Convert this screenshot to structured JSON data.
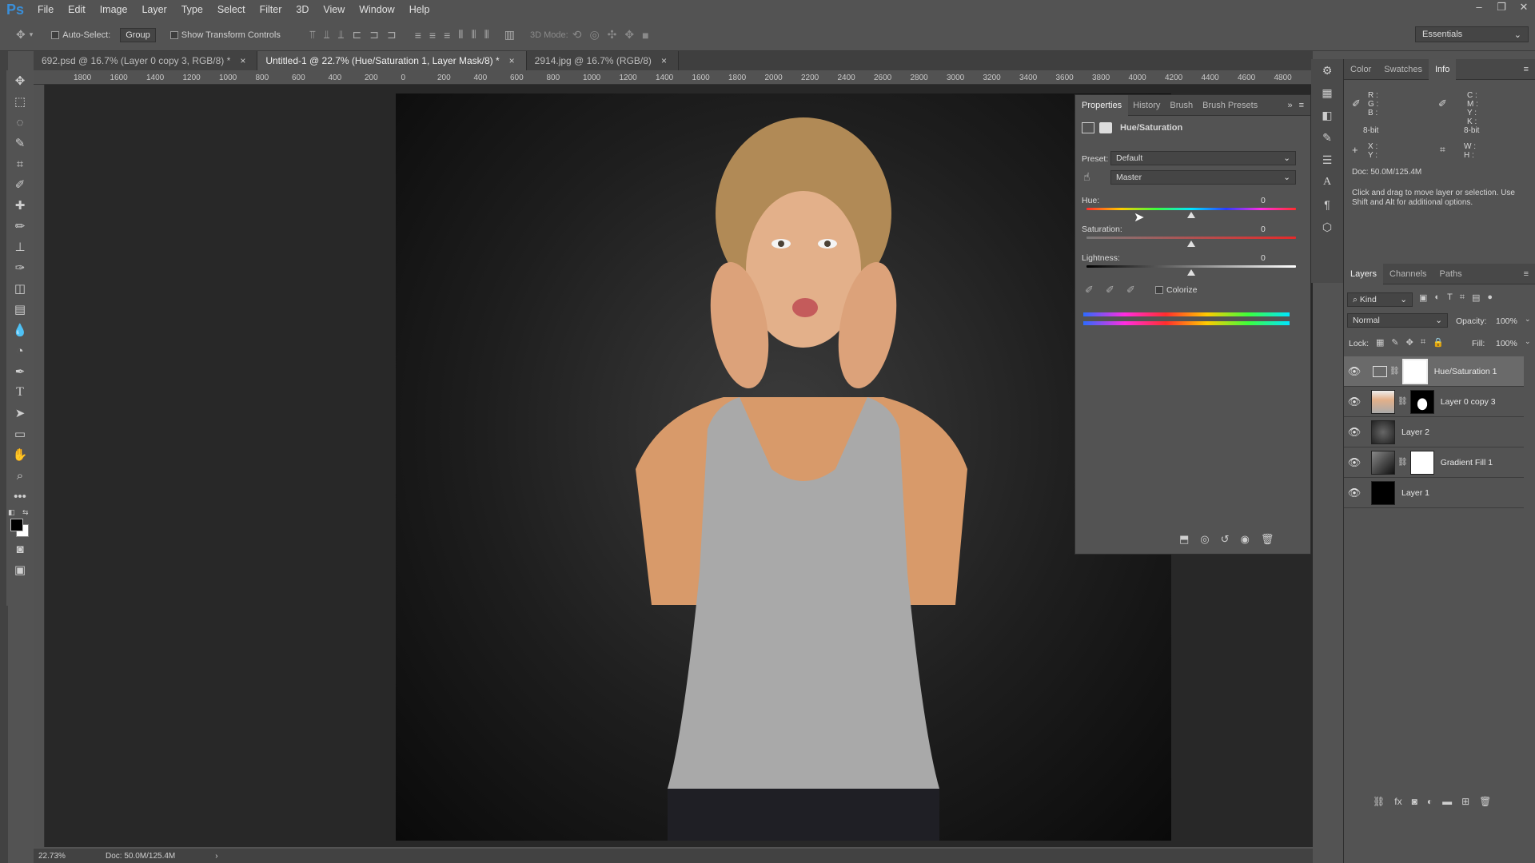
{
  "app": {
    "logo": "Ps"
  },
  "menu": [
    "File",
    "Edit",
    "Image",
    "Layer",
    "Type",
    "Select",
    "Filter",
    "3D",
    "View",
    "Window",
    "Help"
  ],
  "window_controls": {
    "minimize": "–",
    "restore": "❐",
    "close": "✕"
  },
  "options": {
    "auto_select_label": "Auto-Select:",
    "auto_select_value": "Group",
    "transform_label": "Show Transform Controls",
    "mode_3d_label": "3D Mode:"
  },
  "workspace": "Essentials",
  "tabs": [
    {
      "label": "692.psd @ 16.7% (Layer 0 copy 3, RGB/8) *",
      "close": "×"
    },
    {
      "label": "Untitled-1 @ 22.7% (Hue/Saturation 1, Layer Mask/8) *",
      "close": "×"
    },
    {
      "label": "2914.jpg @ 16.7% (RGB/8)",
      "close": "×"
    }
  ],
  "ruler_h": [
    "1800",
    "1600",
    "1400",
    "1200",
    "1000",
    "800",
    "600",
    "400",
    "200",
    "0",
    "200",
    "400",
    "600",
    "800",
    "1000",
    "1200",
    "1400",
    "1600",
    "1800",
    "2000",
    "2200",
    "2400",
    "2600",
    "2800",
    "3000",
    "3200",
    "3400",
    "3600",
    "3800",
    "4000",
    "4200",
    "4400",
    "4600",
    "4800"
  ],
  "status": {
    "zoom": "22.73%",
    "doc": "Doc: 50.0M/125.4M"
  },
  "properties": {
    "tabs": [
      "Properties",
      "History",
      "Brush",
      "Brush Presets"
    ],
    "title": "Hue/Saturation",
    "preset_label": "Preset:",
    "preset_value": "Default",
    "channel_value": "Master",
    "hue_label": "Hue:",
    "hue_value": "0",
    "saturation_label": "Saturation:",
    "saturation_value": "0",
    "lightness_label": "Lightness:",
    "lightness_value": "0",
    "colorize_label": "Colorize",
    "hue": 0,
    "saturation": 0,
    "lightness": 0
  },
  "info_panel": {
    "tabs": [
      "Color",
      "Swatches",
      "Info"
    ],
    "rgb": "R :\nG :\nB :",
    "cmyk": "C :\nM :\nY :\nK :",
    "bit_left": "8-bit",
    "bit_right": "8-bit",
    "xy": "X :\nY :",
    "wh": "W :\nH :",
    "doc": "Doc: 50.0M/125.4M",
    "hint": "Click and drag to move layer or selection. Use Shift and Alt for additional options."
  },
  "layers_panel": {
    "tabs": [
      "Layers",
      "Channels",
      "Paths"
    ],
    "kind_label": "Kind",
    "blend_mode": "Normal",
    "opacity_label": "Opacity:",
    "opacity_value": "100%",
    "lock_label": "Lock:",
    "fill_label": "Fill:",
    "fill_value": "100%",
    "layers": [
      {
        "name": "Hue/Saturation 1",
        "active": true
      },
      {
        "name": "Layer 0 copy 3",
        "active": false
      },
      {
        "name": "Layer 2",
        "active": false
      },
      {
        "name": "Gradient Fill 1",
        "active": false
      },
      {
        "name": "Layer 1",
        "active": false
      }
    ]
  },
  "colors": {
    "accent": "#3a8fd9",
    "panel_bg": "#535353",
    "canvas_bg": "#282828"
  }
}
